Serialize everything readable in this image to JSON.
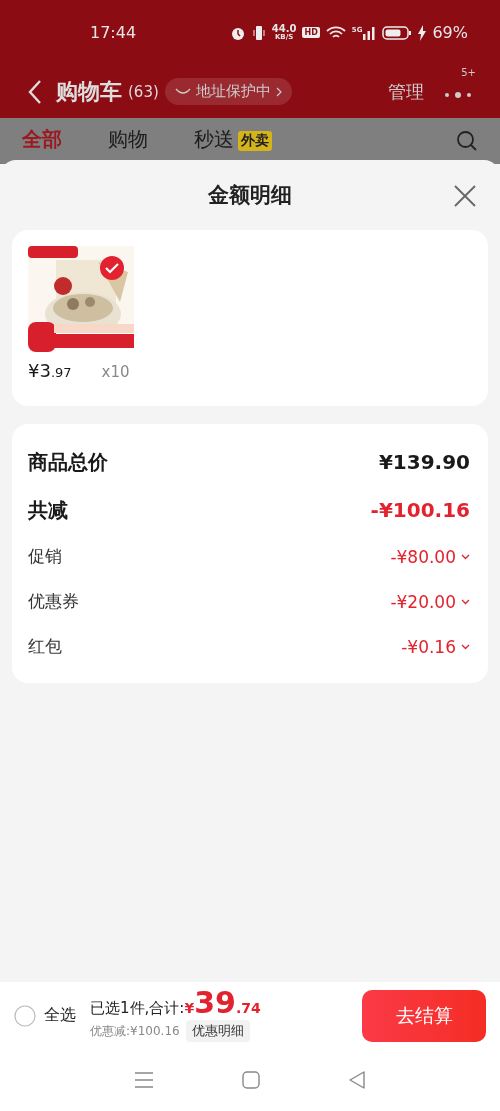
{
  "status_bar": {
    "time": "17:44",
    "speed": "44.0",
    "speed_unit": "KB/S",
    "hd": "HD",
    "network": "5G",
    "battery": "69%"
  },
  "header": {
    "title": "购物车",
    "count": "(63)",
    "address_chip": "地址保护中",
    "manage": "管理",
    "more_badge": "5+"
  },
  "tabs": [
    {
      "label": "全部",
      "selected": true
    },
    {
      "label": "购物",
      "selected": false
    },
    {
      "label": "秒送",
      "selected": false,
      "tag": "外卖"
    }
  ],
  "sheet": {
    "title": "金额明细",
    "items": [
      {
        "kind": "picture",
        "checked": true,
        "price_main": "¥3",
        "price_cents": ".97",
        "qty": "x10"
      }
    ],
    "summary": [
      {
        "kind": "total",
        "label": "商品总价",
        "value": "¥139.90",
        "highlight": false
      },
      {
        "kind": "total",
        "label": "共减",
        "value": "-¥100.16",
        "highlight": true
      },
      {
        "kind": "detail",
        "label": "促销",
        "value": "-¥80.00",
        "highlight": true
      },
      {
        "kind": "detail",
        "label": "优惠券",
        "value": "-¥20.00",
        "highlight": true
      },
      {
        "kind": "detail",
        "label": "红包",
        "value": "-¥0.16",
        "highlight": true
      }
    ]
  },
  "bottom": {
    "select_all": {
      "label": "全选",
      "checked": false
    },
    "selected_text": "已选1件,合计:",
    "currency": "¥",
    "total_int": "39",
    "total_dec": ".74",
    "discount": "优惠减:¥100.16",
    "detail_button": "优惠明细",
    "checkout": "去结算"
  }
}
